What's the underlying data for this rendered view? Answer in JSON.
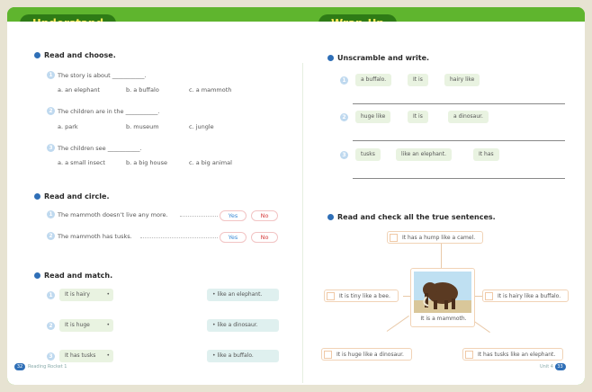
{
  "tabs": {
    "left": "Understand",
    "right": "Wrap-Up"
  },
  "read_choose": {
    "heading": "Read and choose.",
    "questions": [
      {
        "num": "1",
        "text": "The story is about ___________.",
        "options": [
          "a. an elephant",
          "b. a buffalo",
          "c. a mammoth"
        ]
      },
      {
        "num": "2",
        "text": "The children are in the ___________.",
        "options": [
          "a. park",
          "b. museum",
          "c. jungle"
        ]
      },
      {
        "num": "3",
        "text": "The children see ___________.",
        "options": [
          "a. a small insect",
          "b. a big house",
          "c. a big animal"
        ]
      }
    ]
  },
  "read_circle": {
    "heading": "Read and circle.",
    "items": [
      {
        "num": "1",
        "text": "The mammoth doesn’t live any more.",
        "yes": "Yes",
        "no": "No"
      },
      {
        "num": "2",
        "text": "The mammoth has tusks.",
        "yes": "Yes",
        "no": "No"
      }
    ]
  },
  "read_match": {
    "heading": "Read and match.",
    "left": [
      {
        "num": "1",
        "text": "It is hairy"
      },
      {
        "num": "2",
        "text": "It is huge"
      },
      {
        "num": "3",
        "text": "It has tusks"
      }
    ],
    "right": [
      "like an elephant.",
      "like a dinosaur.",
      "like a buffalo."
    ]
  },
  "unscramble": {
    "heading": "Unscramble and write.",
    "rows": [
      {
        "num": "1",
        "words": [
          "a buffalo.",
          "It is",
          "hairy like"
        ]
      },
      {
        "num": "2",
        "words": [
          "huge like",
          "It is",
          "a dinosaur."
        ]
      },
      {
        "num": "3",
        "words": [
          "tusks",
          "like an elephant.",
          "It has"
        ]
      }
    ]
  },
  "check_true": {
    "heading": "Read and check all the true sentences.",
    "center_caption": "It is a mammoth.",
    "options": {
      "top": "It has a hump like a camel.",
      "left": "It is tiny like a bee.",
      "right": "It is hairy like a buffalo.",
      "bottom_left": "It is huge like a dinosaur.",
      "bottom_right": "It has tusks like an elephant."
    }
  },
  "footer": {
    "left_page": "32",
    "left_text": "Reading Rocket 1",
    "right_text": "Unit 4",
    "right_page": "33"
  }
}
